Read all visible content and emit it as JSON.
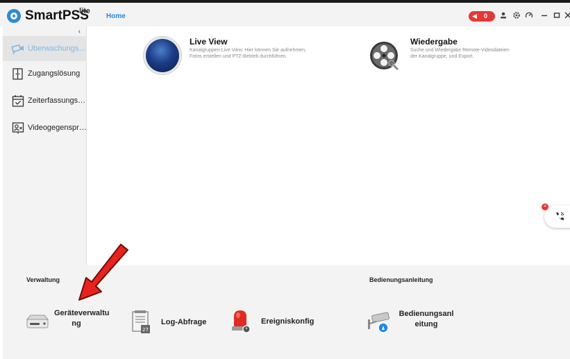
{
  "titlebar": {
    "app_name": "SmartPSS",
    "app_suffix": "lite",
    "home_tab": "Home",
    "alarm_count": "0"
  },
  "sidebar": {
    "items": [
      {
        "label": "Überwachungslös...",
        "icon": "camera-icon",
        "active": true
      },
      {
        "label": "Zugangslösung",
        "icon": "door-icon",
        "active": false
      },
      {
        "label": "Zeiterfassungslös...",
        "icon": "calendar-check-icon",
        "active": false
      },
      {
        "label": "Videogegensprec...",
        "icon": "intercom-icon",
        "active": false
      }
    ]
  },
  "main": {
    "live_view": {
      "title": "Live View",
      "desc": "Kanalgruppen-Live View. Hier können Sie aufnehmen, Fotos erstellen und PTZ-Betrieb durchführen."
    },
    "wiedergabe": {
      "title": "Wiedergabe",
      "desc": "Suche und Wiedergabe Remote-Videodateien der Kanalgruppe, und Export."
    }
  },
  "bottom": {
    "verwaltung_label": "Verwaltung",
    "bedienung_label": "Bedienungsanleitung",
    "items": [
      {
        "label": "Geräteverwaltu ng",
        "icon": "device-icon"
      },
      {
        "label": "Log-Abfrage",
        "icon": "log-icon"
      },
      {
        "label": "Ereigniskonfig",
        "icon": "alarm-light-icon"
      },
      {
        "label": "Bedienungsanl eitung",
        "icon": "manual-camera-icon"
      }
    ]
  },
  "colors": {
    "accent": "#1e88e5",
    "alarm": "#e53935",
    "arrow": "#e8221c"
  }
}
